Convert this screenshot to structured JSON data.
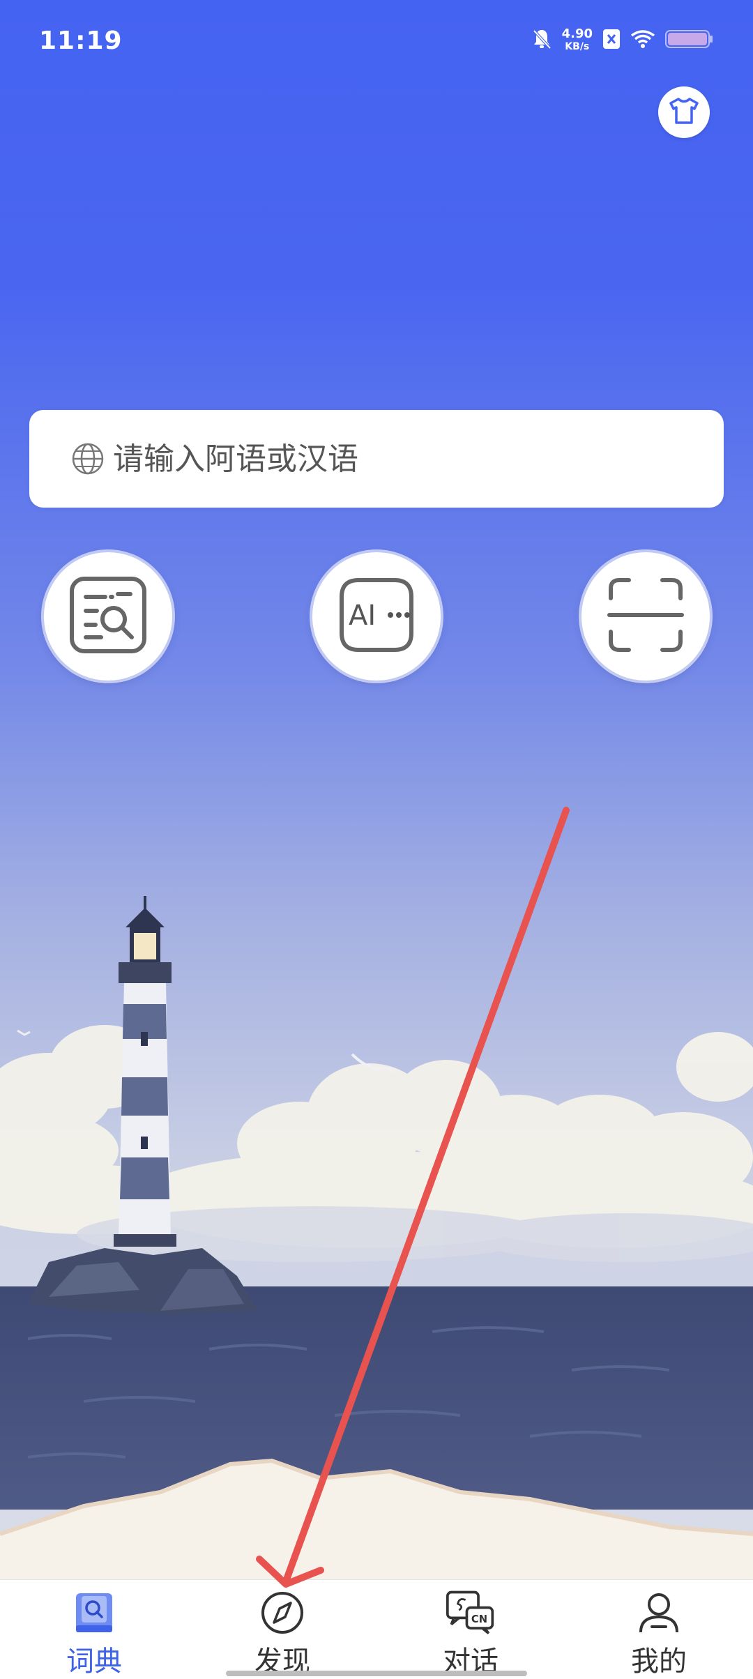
{
  "status_bar": {
    "time": "11:19",
    "net_speed_value": "4.90",
    "net_speed_unit": "KB/s"
  },
  "theme_button": {
    "icon": "tshirt-icon"
  },
  "search": {
    "placeholder": "请输入阿语或汉语",
    "icon": "globe-icon"
  },
  "actions": [
    {
      "name": "document-search",
      "icon": "document-search-icon"
    },
    {
      "name": "ai-chat",
      "icon": "ai-chat-icon",
      "text": "AI"
    },
    {
      "name": "scan",
      "icon": "scan-icon"
    }
  ],
  "bottom_nav": {
    "items": [
      {
        "label": "词典",
        "icon": "dictionary-icon",
        "active": true
      },
      {
        "label": "发现",
        "icon": "compass-icon",
        "active": false
      },
      {
        "label": "对话",
        "icon": "dialogue-icon",
        "active": false,
        "badge": "CN"
      },
      {
        "label": "我的",
        "icon": "profile-icon",
        "active": false
      }
    ]
  },
  "colors": {
    "sky_top": "#4563F2",
    "sky_bottom": "#C8CFE6",
    "active_nav": "#3F63E8",
    "annotation_arrow": "#E8534F"
  }
}
